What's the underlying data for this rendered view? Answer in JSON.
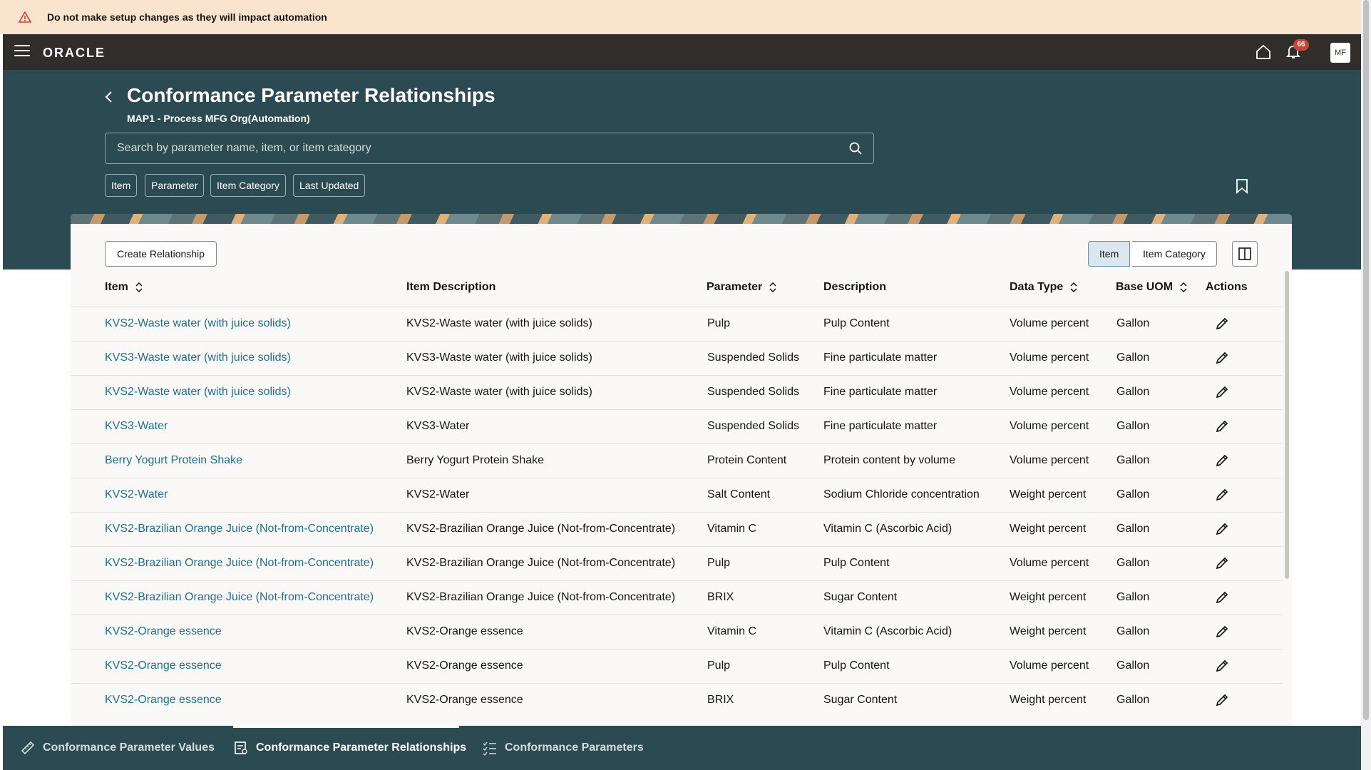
{
  "banner": {
    "text": "Do not make setup changes as they will impact automation"
  },
  "header": {
    "logo": "ORACLE",
    "notifications_count": "66",
    "avatar_initials": "MF"
  },
  "page": {
    "title": "Conformance Parameter Relationships",
    "subtitle": "MAP1 - Process MFG Org(Automation)",
    "search_placeholder": "Search by parameter name, item, or item category",
    "filters": [
      "Item",
      "Parameter",
      "Item Category",
      "Last Updated"
    ]
  },
  "toolbar": {
    "create_label": "Create Relationship",
    "view_toggle": [
      "Item",
      "Item Category"
    ],
    "view_selected": "Item"
  },
  "table": {
    "columns": [
      "Item",
      "Item Description",
      "Parameter",
      "Description",
      "Data Type",
      "Base UOM",
      "Actions"
    ],
    "rows": [
      [
        "KVS2-Waste water (with juice solids)",
        "KVS2-Waste water (with juice solids)",
        "Pulp",
        "Pulp Content",
        "Volume percent",
        "Gallon"
      ],
      [
        "KVS3-Waste water (with juice solids)",
        "KVS3-Waste water (with juice solids)",
        "Suspended Solids",
        "Fine particulate matter",
        "Volume percent",
        "Gallon"
      ],
      [
        "KVS2-Waste water (with juice solids)",
        "KVS2-Waste water (with juice solids)",
        "Suspended Solids",
        "Fine particulate matter",
        "Volume percent",
        "Gallon"
      ],
      [
        "KVS3-Water",
        "KVS3-Water",
        "Suspended Solids",
        "Fine particulate matter",
        "Volume percent",
        "Gallon"
      ],
      [
        "Berry Yogurt Protein Shake",
        "Berry Yogurt Protein Shake",
        "Protein Content",
        "Protein content by volume",
        "Volume percent",
        "Gallon"
      ],
      [
        "KVS2-Water",
        "KVS2-Water",
        "Salt Content",
        "Sodium Chloride concentration",
        "Weight percent",
        "Gallon"
      ],
      [
        "KVS2-Brazilian Orange Juice (Not-from-Concentrate)",
        "KVS2-Brazilian Orange Juice (Not-from-Concentrate)",
        "Vitamin C",
        "Vitamin C (Ascorbic Acid)",
        "Weight percent",
        "Gallon"
      ],
      [
        "KVS2-Brazilian Orange Juice (Not-from-Concentrate)",
        "KVS2-Brazilian Orange Juice (Not-from-Concentrate)",
        "Pulp",
        "Pulp Content",
        "Volume percent",
        "Gallon"
      ],
      [
        "KVS2-Brazilian Orange Juice (Not-from-Concentrate)",
        "KVS2-Brazilian Orange Juice (Not-from-Concentrate)",
        "BRIX",
        "Sugar Content",
        "Weight percent",
        "Gallon"
      ],
      [
        "KVS2-Orange essence",
        "KVS2-Orange essence",
        "Vitamin C",
        "Vitamin C (Ascorbic Acid)",
        "Weight percent",
        "Gallon"
      ],
      [
        "KVS2-Orange essence",
        "KVS2-Orange essence",
        "Pulp",
        "Pulp Content",
        "Volume percent",
        "Gallon"
      ],
      [
        "KVS2-Orange essence",
        "KVS2-Orange essence",
        "BRIX",
        "Sugar Content",
        "Weight percent",
        "Gallon"
      ]
    ]
  },
  "bottom_nav": {
    "items": [
      "Conformance Parameter Values",
      "Conformance Parameter Relationships",
      "Conformance Parameters"
    ],
    "active": "Conformance Parameter Relationships"
  },
  "colors": {
    "banner_bg": "#fbe4cd",
    "header_bg": "#312d2a",
    "hero_bg": "#2c4a51",
    "link": "#1f6f94"
  }
}
